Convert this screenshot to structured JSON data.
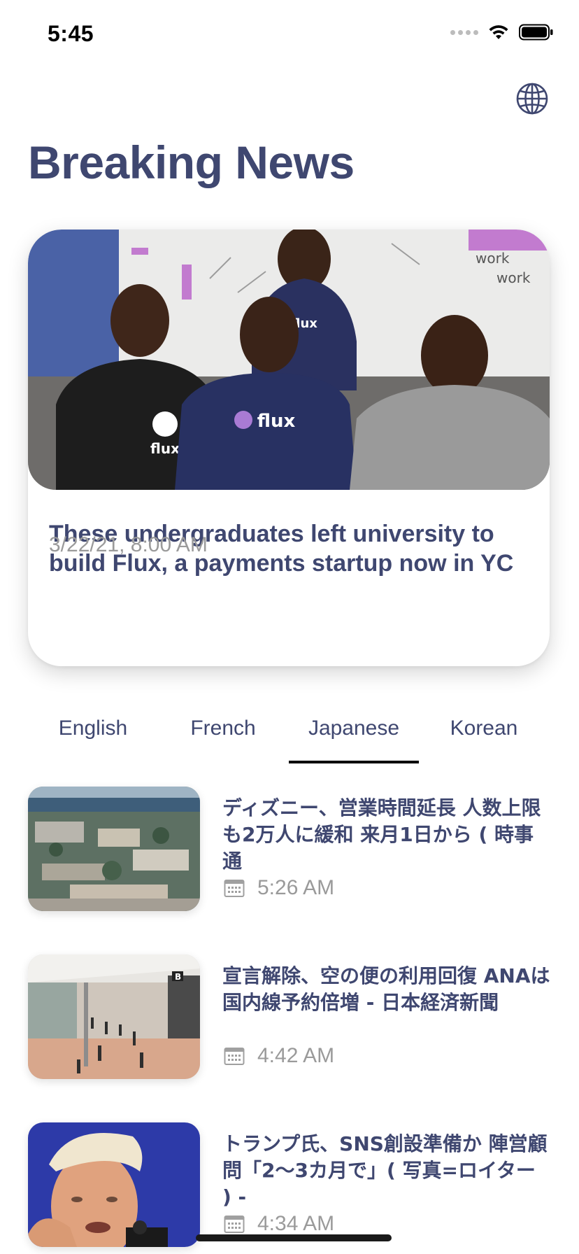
{
  "status_bar": {
    "time": "5:45"
  },
  "header": {
    "title": "Breaking News",
    "globe_icon": "globe-icon"
  },
  "featured": {
    "headline": "These undergraduates left university to build Flux, a payments startup now in YC",
    "date": "3/22/21, 8:00 AM",
    "image_text": {
      "shirt_left": "flux",
      "shirt_center": "flux",
      "shirt_top": "flux",
      "board_line1": "work",
      "board_line2": "work"
    }
  },
  "tabs": [
    {
      "label": "English",
      "selected": false
    },
    {
      "label": "French",
      "selected": false
    },
    {
      "label": "Japanese",
      "selected": true
    },
    {
      "label": "Korean",
      "selected": false
    }
  ],
  "articles": [
    {
      "title": "ディズニー、営業時間延長 人数上限も2万人に緩和 来月1日から ( 時事通",
      "time": "5:26 AM",
      "icon": "calendar-icon"
    },
    {
      "title": "宣言解除、空の便の利用回復 ANAは国内線予約倍増 - 日本経済新聞",
      "time": "4:42 AM",
      "icon": "calendar-icon"
    },
    {
      "title": "トランプ氏、SNS創設準備か 陣営顧問「2～3カ月で」( 写真=ロイター ) -",
      "time": "4:34 AM",
      "icon": "calendar-icon"
    }
  ],
  "colors": {
    "title": "#3f4770",
    "meta": "#9a9a9a",
    "indicator": "#000000"
  }
}
